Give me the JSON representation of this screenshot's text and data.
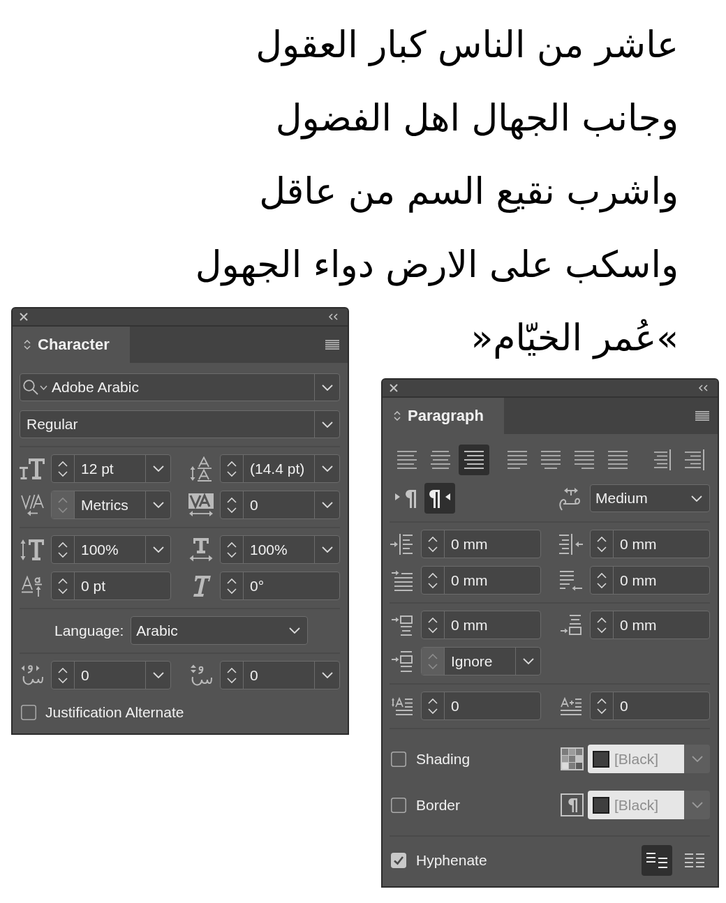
{
  "poem": {
    "lines": [
      "عاشر من الناس كبار العقول",
      "وجانب الجهال اهل الفضول",
      "واشرب نقيع السم من عاقل",
      "واسكب على الارض دواء الجهول"
    ],
    "attribution": "»عُمر الخيّام«"
  },
  "character_panel": {
    "title": "Character",
    "font_family": "Adobe Arabic",
    "font_style": "Regular",
    "sections": [
      {
        "kind": "fields",
        "fields": [
          {
            "kind": "combo",
            "value": "12 pt",
            "stepper_disabled": false
          },
          {
            "kind": "combo",
            "value": "(14.4 pt)",
            "stepper_disabled": false
          },
          {
            "kind": "combo",
            "value": "Metrics",
            "stepper_disabled": true
          },
          {
            "kind": "combo",
            "value": "0",
            "stepper_disabled": false
          }
        ]
      },
      {
        "kind": "fields",
        "fields": [
          {
            "kind": "combo",
            "value": "100%",
            "stepper_disabled": false
          },
          {
            "kind": "combo",
            "value": "100%",
            "stepper_disabled": false
          },
          {
            "kind": "spin",
            "value": "0 pt",
            "stepper_disabled": false
          },
          {
            "kind": "spin",
            "value": "0°",
            "stepper_disabled": false
          }
        ]
      },
      {
        "kind": "dropdown",
        "label": "Language:",
        "value": "Arabic"
      },
      {
        "kind": "fields",
        "fields": [
          {
            "kind": "combo",
            "value": "0",
            "stepper_disabled": false
          },
          {
            "kind": "combo",
            "value": "0",
            "stepper_disabled": false
          }
        ]
      }
    ],
    "checkbox": {
      "label": "Justification Alternate",
      "checked": false
    }
  },
  "paragraph_panel": {
    "title": "Paragraph",
    "alignment": [
      {
        "selected": false
      },
      {
        "selected": false
      },
      {
        "selected": true
      },
      {
        "selected": false
      },
      {
        "selected": false
      },
      {
        "selected": false
      },
      {
        "selected": false
      },
      {
        "selected": false
      },
      {
        "selected": false
      }
    ],
    "direction": [
      {
        "selected": false
      },
      {
        "selected": true
      }
    ],
    "kashida": "Medium",
    "sections": [
      {
        "kind": "fields",
        "fields": [
          {
            "kind": "spin",
            "value": "0 mm",
            "stepper_disabled": false
          },
          {
            "kind": "spin",
            "value": "0 mm",
            "stepper_disabled": false
          },
          {
            "kind": "spin",
            "value": "0 mm",
            "stepper_disabled": false
          },
          {
            "kind": "spin",
            "value": "0 mm",
            "stepper_disabled": false
          }
        ]
      },
      {
        "kind": "fields",
        "fields": [
          {
            "kind": "spin",
            "value": "0 mm",
            "stepper_disabled": false
          },
          {
            "kind": "spin",
            "value": "0 mm",
            "stepper_disabled": false
          },
          {
            "kind": "combo",
            "value": "Ignore",
            "stepper_disabled": true
          }
        ]
      },
      {
        "kind": "fields",
        "fields": [
          {
            "kind": "spin",
            "value": "0",
            "stepper_disabled": false
          },
          {
            "kind": "spin",
            "value": "0",
            "stepper_disabled": false
          }
        ]
      }
    ],
    "options": [
      {
        "label": "Shading",
        "checked": false,
        "swatch": {
          "value": "[Black]",
          "disabled": true
        }
      },
      {
        "label": "Border",
        "checked": false,
        "swatch": {
          "value": "[Black]",
          "disabled": true
        }
      }
    ],
    "hyphenate": {
      "label": "Hyphenate",
      "checked": true
    },
    "composer": [
      {
        "selected": true
      },
      {
        "selected": false
      }
    ]
  }
}
